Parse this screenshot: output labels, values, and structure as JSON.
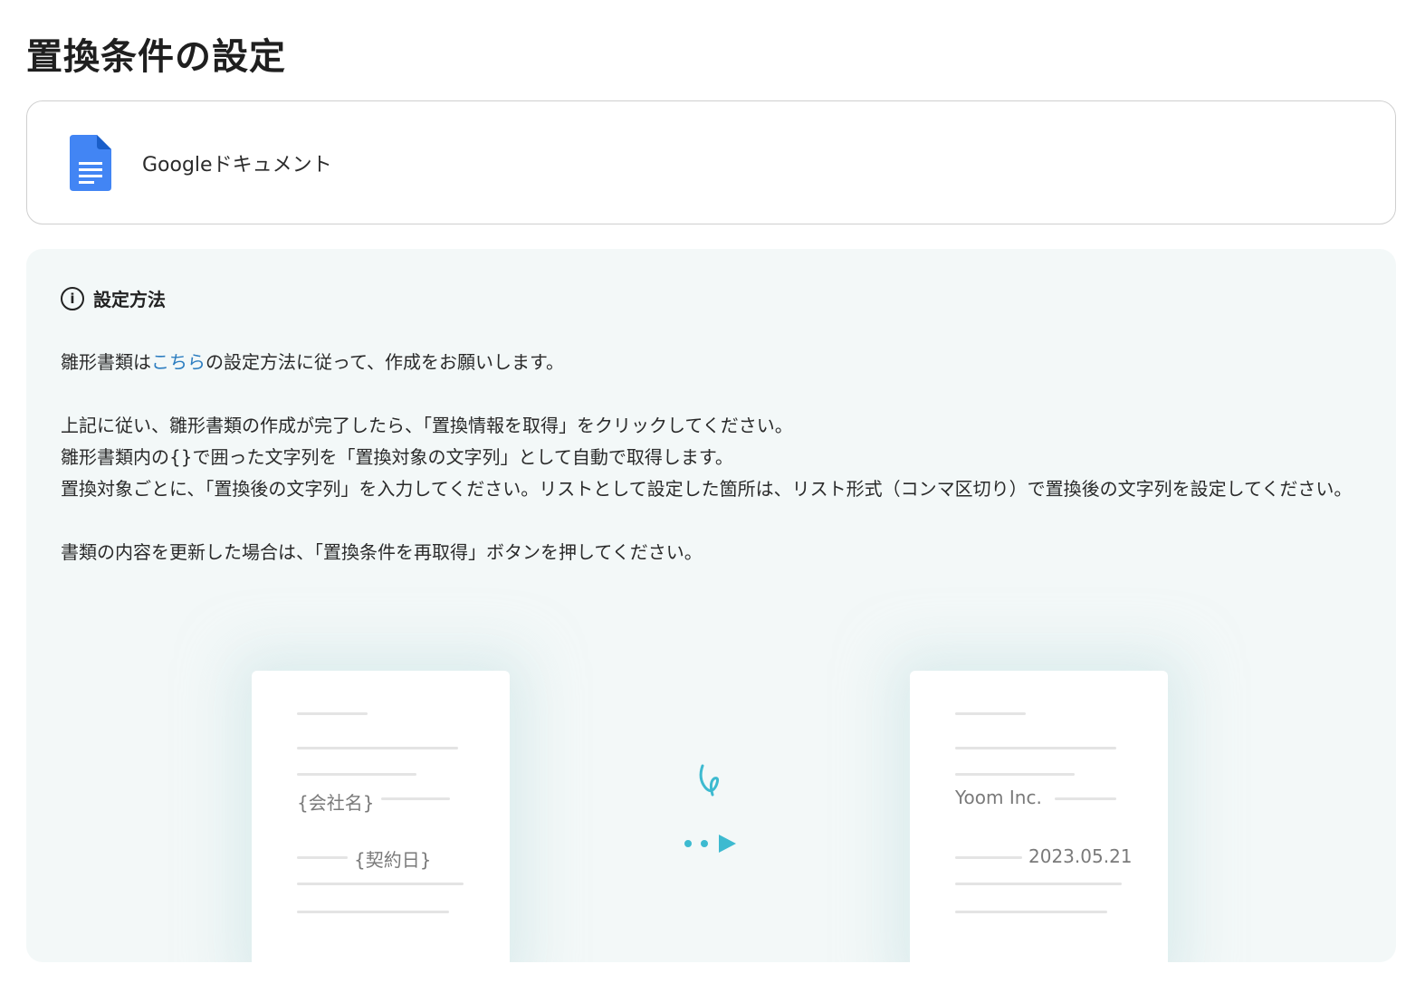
{
  "page": {
    "title": "置換条件の設定"
  },
  "app": {
    "name": "Googleドキュメント",
    "icon": "google-docs-icon",
    "icon_color": "#4285F4"
  },
  "info": {
    "icon": "info-circle-icon",
    "title": "設定方法",
    "line1_prefix": "雛形書類は",
    "line1_link": "こちら",
    "line1_suffix": "の設定方法に従って、作成をお願いします。",
    "line2": "上記に従い、雛形書類の作成が完了したら、「置換情報を取得」をクリックしてください。",
    "line3": "雛形書類内の{}で囲った文字列を「置換対象の文字列」として自動で取得します。",
    "line4": "置換対象ごとに、「置換後の文字列」を入力してください。リストとして設定した箇所は、リスト形式（コンマ区切り）で置換後の文字列を設定してください。",
    "line5": "書類の内容を更新した場合は、「置換条件を再取得」ボタンを押してください。",
    "link_color": "#2c7dc0"
  },
  "illustration": {
    "template_doc": {
      "field1": "{会社名}",
      "field2": "{契約日}"
    },
    "result_doc": {
      "field1": "Yoom Inc.",
      "field2": "2023.05.21"
    },
    "arrow_icon": "transform-arrow-icon",
    "accent_color": "#3dbad0"
  }
}
